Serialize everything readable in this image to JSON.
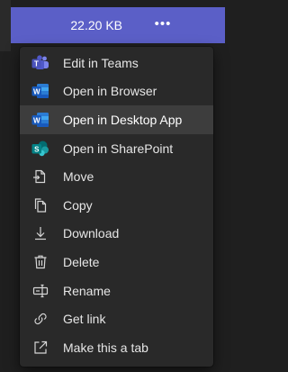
{
  "file_row": {
    "size": "22.20 KB",
    "more_label": "•••"
  },
  "menu": {
    "items": [
      {
        "label": "Edit in Teams",
        "icon": "teams-icon"
      },
      {
        "label": "Open in Browser",
        "icon": "word-icon"
      },
      {
        "label": "Open in Desktop App",
        "icon": "word-icon"
      },
      {
        "label": "Open in SharePoint",
        "icon": "sharepoint-icon"
      },
      {
        "label": "Move",
        "icon": "move-icon"
      },
      {
        "label": "Copy",
        "icon": "copy-icon"
      },
      {
        "label": "Download",
        "icon": "download-icon"
      },
      {
        "label": "Delete",
        "icon": "delete-icon"
      },
      {
        "label": "Rename",
        "icon": "rename-icon"
      },
      {
        "label": "Get link",
        "icon": "link-icon"
      },
      {
        "label": "Make this a tab",
        "icon": "open-external-icon"
      }
    ],
    "hovered_index": 2
  },
  "colors": {
    "accent": "#5b5fc7",
    "menu_bg": "#292929",
    "hover_bg": "#3d3d3d",
    "word_blue": "#185abd",
    "sharepoint_teal": "#038387"
  }
}
